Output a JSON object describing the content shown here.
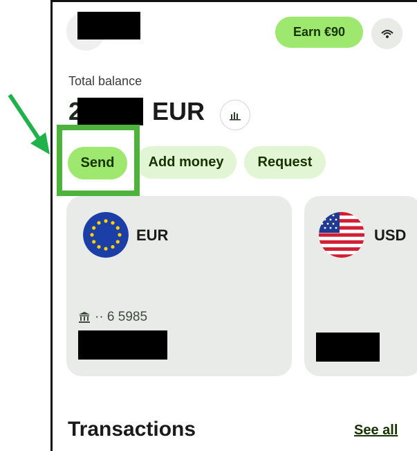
{
  "header": {
    "earn_label": "Earn €90",
    "eye_icon": "eye-icon"
  },
  "balance": {
    "label": "Total balance",
    "first_digit": "2",
    "currency": "EUR",
    "chart_icon": "bar-chart-icon"
  },
  "actions": {
    "send": "Send",
    "add_money": "Add money",
    "request": "Request"
  },
  "accounts": [
    {
      "currency": "EUR",
      "flag_icon": "eu-flag-icon",
      "bank_icon": "bank-icon",
      "account_tail": "·· 6 5985"
    },
    {
      "currency": "USD",
      "flag_icon": "us-flag-icon"
    }
  ],
  "transactions": {
    "title": "Transactions",
    "see_all": "See all"
  },
  "colors": {
    "primary_green": "#9fe870",
    "light_green": "#e2f6d5",
    "dark_green_text": "#163300",
    "card_gray": "#e9ebe8",
    "annotation_green": "#4db33d"
  }
}
